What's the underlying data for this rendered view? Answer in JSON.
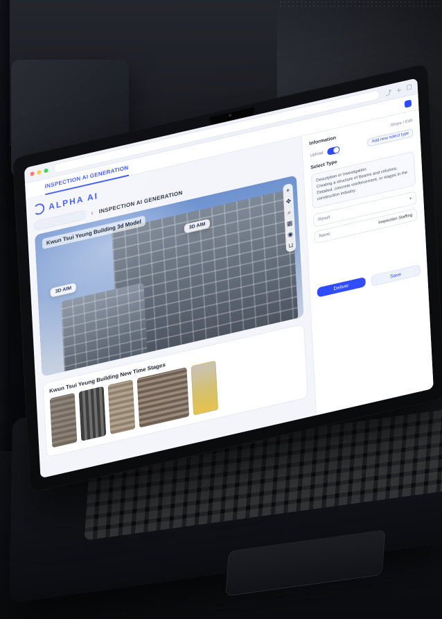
{
  "brand": {
    "name": "ALPHA AI"
  },
  "browser": {
    "active_tab_label": "INSPECTION AI GENERATION"
  },
  "page": {
    "title": "INSPECTION AI GENERATION"
  },
  "main_image": {
    "title": "Kwun Tsui Yeung Building 3d Model",
    "tag_primary": "3D AIM",
    "tag_secondary": "3D AIM"
  },
  "stages": {
    "title": "Kwun Tsui Yeung Building New Time Stages"
  },
  "side_panel": {
    "title": "Information",
    "meta": "Share / Edit",
    "toggle_label": "Upload",
    "add_button": "Add new select type",
    "section_label": "Select Type",
    "description": "Description or Investigation\nCreating a structure of Beams and columns. Detailed, concrete reinforcement, or stages in the construction industry.",
    "field_1_label": "Result",
    "field_2_label": "Name",
    "field_2_value": "Inspection Staffing",
    "primary_button": "Deliver",
    "secondary_button": "Save"
  },
  "colors": {
    "accent": "#2f4bff"
  }
}
